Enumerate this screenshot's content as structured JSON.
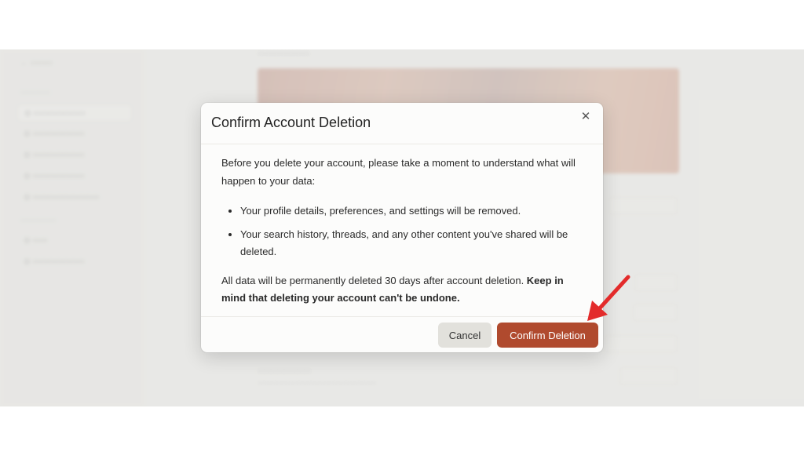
{
  "colors": {
    "accent": "#b04a2e",
    "annotation_arrow": "#e32b2b",
    "page_background": "#efefed",
    "hero_image": "#c98a70"
  },
  "modal": {
    "title": "Confirm Account Deletion",
    "close_icon": "close-icon",
    "intro": "Before you delete your account, please take a moment to understand what will happen to your data:",
    "bullets": [
      "Your profile details, preferences, and settings will be removed.",
      "Your search history, threads, and any other content you've shared will be deleted."
    ],
    "closing_normal": "All data will be permanently deleted 30 days after account deletion. ",
    "closing_bold": "Keep in mind that deleting your account can't be undone.",
    "cancel_label": "Cancel",
    "confirm_label": "Confirm Deletion"
  },
  "annotation": {
    "icon": "red-arrow-icon"
  }
}
